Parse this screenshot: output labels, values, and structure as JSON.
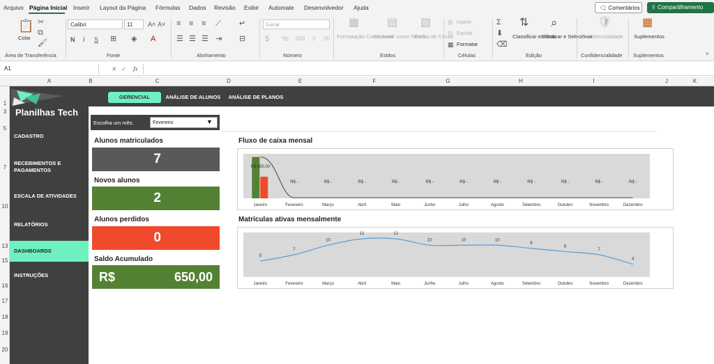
{
  "menu": {
    "items": [
      "Arquivo",
      "Página Inicial",
      "Inserir",
      "Layout da Página",
      "Fórmulas",
      "Dados",
      "Revisão",
      "Exibir",
      "Automate",
      "Desenvolvedor",
      "Ajuda"
    ],
    "comments_label": "Comentários",
    "share_label": "Compartilhamento"
  },
  "ribbon": {
    "clipboard": {
      "paste_label": "Colar",
      "group_label": "Área de Transferência"
    },
    "font": {
      "font_name": "Calibri",
      "font_size": "11",
      "group_label": "Fonte"
    },
    "alignment": {
      "group_label": "Alinhamento"
    },
    "number": {
      "format_value": "Geral",
      "group_label": "Número"
    },
    "styles": {
      "conditional_label": "Formatação Condicional",
      "table_label": "Formatar como Tabela",
      "cell_styles_label": "Estilos de Célula",
      "group_label": "Estilos"
    },
    "cells": {
      "insert_label": "Inserir",
      "delete_label": "Excluir",
      "format_label": "Formatar",
      "group_label": "Células"
    },
    "editing": {
      "sort_label": "Classificar e Filtrar",
      "find_label": "Localizar e Selecionar",
      "group_label": "Edição"
    },
    "sensitivity": {
      "label": "Confidencialidade",
      "group_label": "Confidencialidade"
    },
    "addins": {
      "label": "Suplementos",
      "group_label": "Suplementos"
    }
  },
  "formula_bar": {
    "name_box": "A1",
    "fx": "fx",
    "value": ""
  },
  "columns": [
    "A",
    "B",
    "C",
    "D",
    "E",
    "F",
    "G",
    "H",
    "I",
    "J",
    "K"
  ],
  "rows": [
    "1",
    "3",
    "5",
    "7",
    "10",
    "13",
    "15",
    "16",
    "17",
    "18",
    "19",
    "20"
  ],
  "sidebar": {
    "title": "Planilhas Tech",
    "items": [
      "CADASTRO",
      "RECEBIMENTOS E PAGAMENTOS",
      "ESCALA DE ATIVIDADES",
      "RELATÓRIOS",
      "DASHBOARDS",
      "INSTRUÇÕES"
    ],
    "active_index": 4
  },
  "tabs": {
    "items": [
      "GERENCIAL",
      "ANÁLISE DE ALUNOS",
      "ANÁLISE DE PLANOS"
    ],
    "active_index": 0
  },
  "month_selector": {
    "label": "Escolha um mês:",
    "value": "Fevereiro"
  },
  "kpis": {
    "enrolled": {
      "label": "Alunos matriculados",
      "value": "7",
      "color": "#595959"
    },
    "new": {
      "label": "Novos alunos",
      "value": "2",
      "color": "#548235"
    },
    "lost": {
      "label": "Alunos perdidos",
      "value": "0",
      "color": "#f04a2d"
    },
    "balance": {
      "label": "Saldo Acumulado",
      "currency": "R$",
      "value": "650,00",
      "color": "#548235"
    }
  },
  "chart_data": [
    {
      "type": "bar",
      "title": "Fluxo de caixa mensal",
      "categories": [
        "Janeiro",
        "Fevereiro",
        "Março",
        "Abril",
        "Maio",
        "Junho",
        "Julho",
        "Agosto",
        "Setembro",
        "Outubro",
        "Novembro",
        "Dezembro"
      ],
      "series": [
        {
          "values": [
            650,
            0,
            0,
            0,
            0,
            0,
            0,
            0,
            0,
            0,
            0,
            0
          ],
          "color": "#548235"
        },
        {
          "values": [
            340,
            0,
            0,
            0,
            0,
            0,
            0,
            0,
            0,
            0,
            0,
            0
          ],
          "color": "#f04a2d"
        }
      ],
      "line_values": [
        650,
        10,
        10,
        10,
        10,
        10,
        10,
        10,
        10,
        10,
        10,
        10
      ],
      "data_labels": [
        "R$ 650,00",
        "R$ -",
        "R$ -",
        "R$ -",
        "R$ -",
        "R$ -",
        "R$ -",
        "R$ -",
        "R$ -",
        "R$ -",
        "R$ -",
        "R$ -"
      ],
      "ylim": [
        0,
        700
      ],
      "grid": false
    },
    {
      "type": "line",
      "title": "Matrículas ativas mensalmente",
      "categories": [
        "Janeiro",
        "Fevereiro",
        "Março",
        "Abril",
        "Maio",
        "Junho",
        "Julho",
        "Agosto",
        "Setembro",
        "Outubro",
        "Novembro",
        "Dezembro"
      ],
      "values": [
        5,
        7,
        10,
        12,
        12,
        10,
        10,
        10,
        9,
        8,
        7,
        4
      ],
      "color": "#5b9bd5",
      "ylim": [
        0,
        14
      ],
      "grid": false
    }
  ]
}
